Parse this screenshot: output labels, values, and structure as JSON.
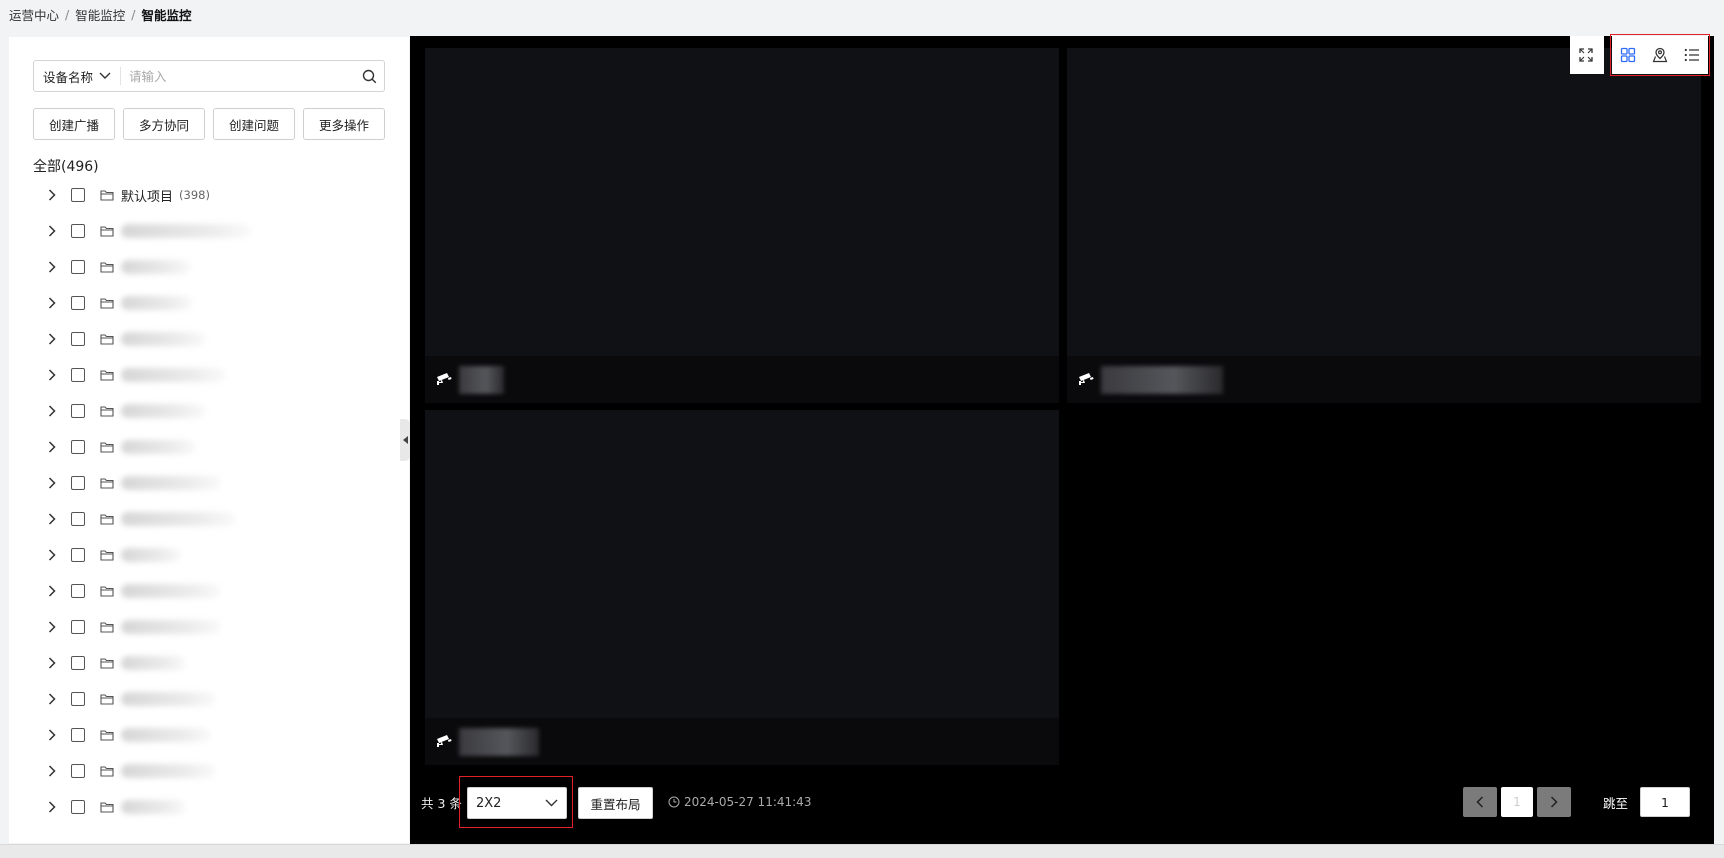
{
  "breadcrumb": [
    "运营中心",
    "智能监控",
    "智能监控"
  ],
  "search": {
    "type_label": "设备名称",
    "placeholder": "请输入"
  },
  "actions": [
    "创建广播",
    "多方协同",
    "创建问题",
    "更多操作"
  ],
  "tree": {
    "all_label": "全部(496)",
    "first_item": {
      "label": "默认项目",
      "count": "(398)"
    }
  },
  "icons": {
    "breadcrumb_sep": "/",
    "fullscreen": "fullscreen-icon",
    "grid_view": "grid-view-icon",
    "map_view": "map-view-icon",
    "list_view": "list-view-icon",
    "camera": "camera-icon",
    "folder": "folder-icon",
    "chevron": "chevron-right-icon"
  },
  "colors": {
    "active_tool": "#2f6cf6",
    "highlight_border": "#e0212a",
    "video_bg": "#101115"
  },
  "footer": {
    "total": "共 3 条",
    "layout_value": "2X2",
    "reset_label": "重置布局",
    "timestamp": "2024-05-27 11:41:43",
    "page": "1",
    "jump_label": "跳至",
    "jump_value": "1"
  }
}
